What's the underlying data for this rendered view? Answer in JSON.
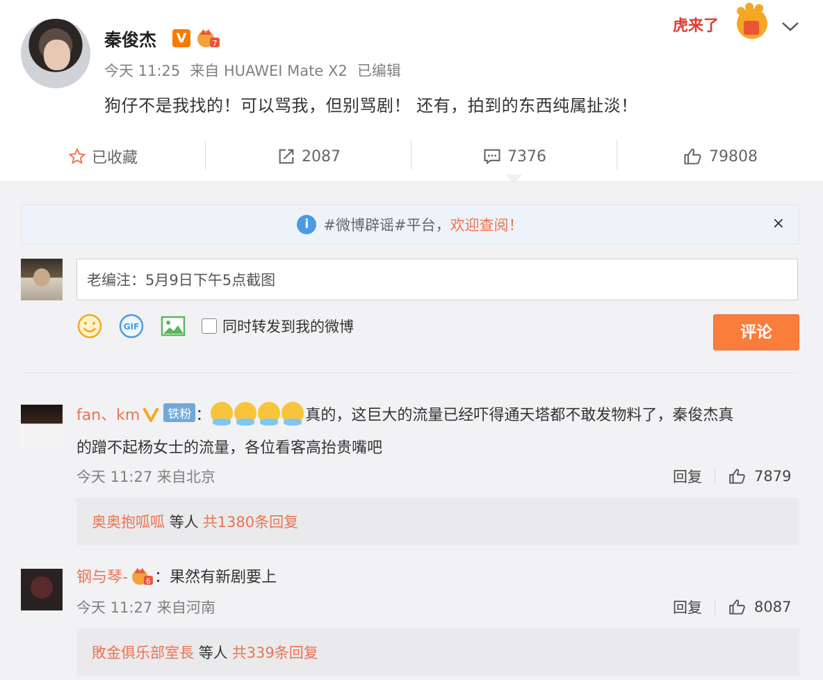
{
  "post": {
    "author": "秦俊杰",
    "verified_mark": "V",
    "time": "今天 11:25",
    "source": "来自 HUAWEI Mate X2",
    "edited": "已编辑",
    "content": "狗仔不是我找的！可以骂我，但别骂剧！ 还有，拍到的东西纯属扯淡！",
    "festive_badge": "虎来了"
  },
  "actions": {
    "favorite_label": "已收藏",
    "repost_count": "2087",
    "comment_count": "7376",
    "like_count": "79808"
  },
  "notice": {
    "text": "#微博辟谣#平台，",
    "link": "欢迎查阅！",
    "close": "×"
  },
  "reply_box": {
    "value": "老编注：5月9日下午5点截图",
    "sync_label": "同时转发到我的微博",
    "submit_label": "评论"
  },
  "comments": [
    {
      "name": "fan、km",
      "badge": "铁粉",
      "colon": "：",
      "text_line1": "真的，这巨大的流量已经吓得通天塔都不敢发物料了，秦俊杰真",
      "text_line2": "的蹭不起杨女士的流量，各位看客高抬贵嘴吧",
      "meta": "今天 11:27 来自北京",
      "reply_label": "回复",
      "likes": "7879",
      "sub_name": "奥奥抱呱呱",
      "sub_mid": "等人",
      "sub_total": "共1380条回复"
    },
    {
      "name": "钢与琴-",
      "colon": "：",
      "text_line1": "果然有新剧要上",
      "meta": "今天 11:27 来自河南",
      "reply_label": "回复",
      "likes": "8087",
      "sub_name": "敗金俱乐部室長",
      "sub_mid": "等人",
      "sub_total": "共339条回复"
    }
  ],
  "colors": {
    "accent_orange": "#fa7d3c",
    "link_orange": "#eb7350",
    "info_blue": "#4a9be3",
    "verified_orange": "#f57c00"
  },
  "icons": [
    "star-icon",
    "repost-icon",
    "comment-icon",
    "thumbs-up-icon",
    "info-icon",
    "close-icon",
    "emoji-icon",
    "gif-icon",
    "image-icon",
    "checkbox-icon",
    "chevron-down-icon",
    "crown-icon"
  ]
}
